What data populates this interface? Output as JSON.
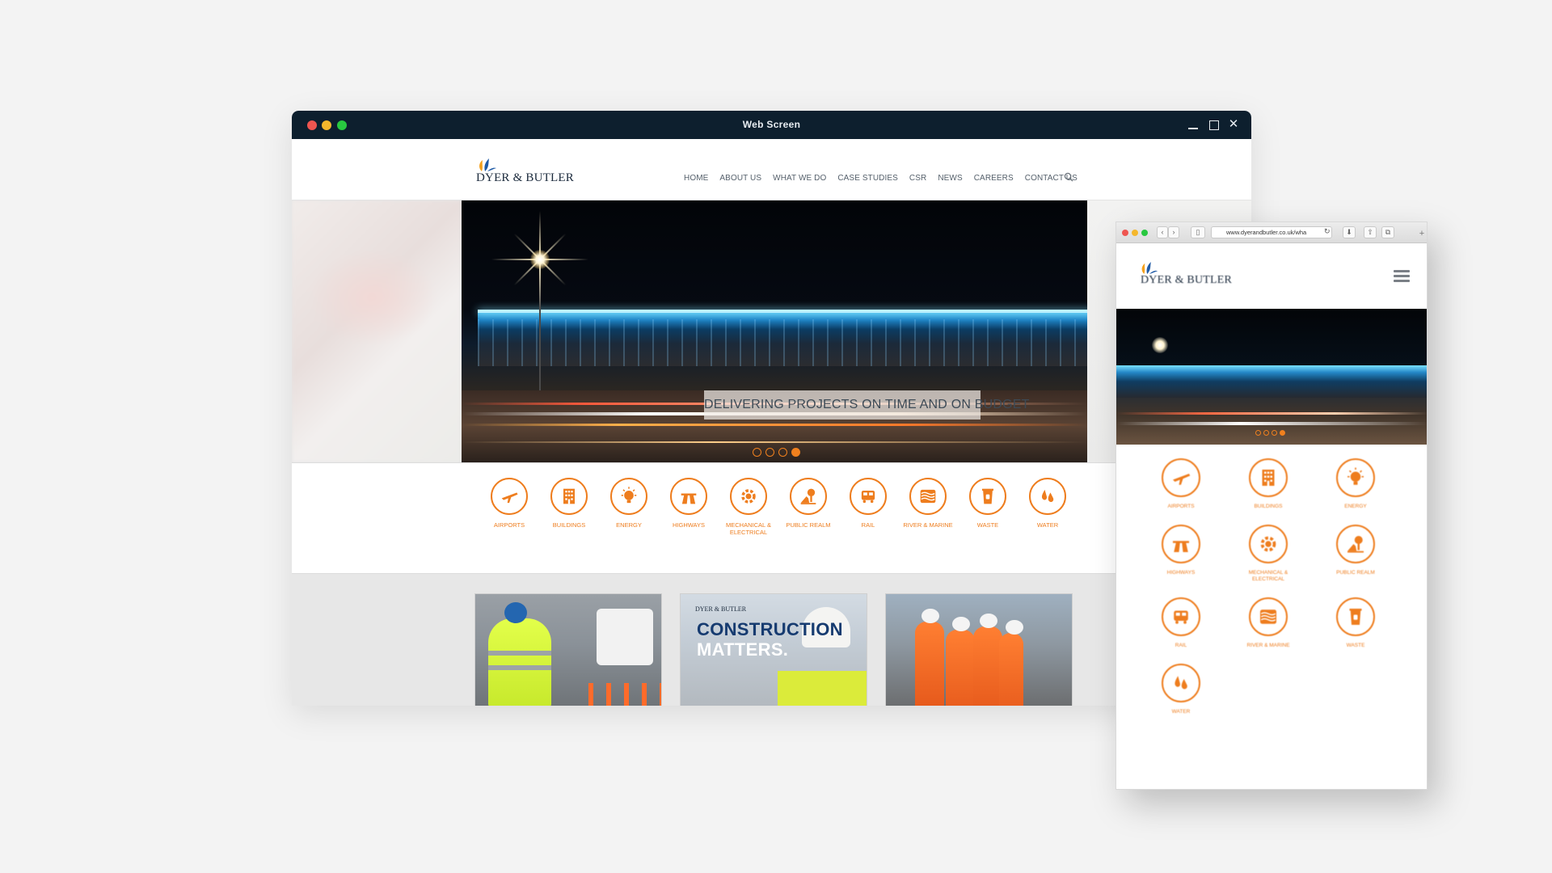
{
  "desktop": {
    "window_title": "Web Screen",
    "brand": "DYER & BUTLER",
    "nav": [
      "HOME",
      "ABOUT US",
      "WHAT WE DO",
      "CASE STUDIES",
      "CSR",
      "NEWS",
      "CAREERS",
      "CONTACT US"
    ],
    "hero_caption": "DELIVERING PROJECTS ON TIME AND ON BUDGET",
    "slider_total": 4,
    "slider_active": 4,
    "services": [
      "AIRPORTS",
      "BUILDINGS",
      "ENERGY",
      "HIGHWAYS",
      "MECHANICAL &\nELECTRICAL",
      "PUBLIC REALM",
      "RAIL",
      "RIVER & MARINE",
      "WASTE",
      "WATER"
    ],
    "cards": {
      "card2_logo": "DYER & BUTLER",
      "card2_title_line1": "CONSTRUCTION",
      "card2_title_line2": "MATTERS."
    }
  },
  "mobile": {
    "url": "www.dyerandbutler.co.uk/wha",
    "brand": "DYER & BUTLER",
    "slider_active": 4,
    "services": [
      "AIRPORTS",
      "BUILDINGS",
      "ENERGY",
      "HIGHWAYS",
      "MECHANICAL &\nELECTRICAL",
      "PUBLIC REALM",
      "RAIL",
      "RIVER & MARINE",
      "WASTE",
      "WATER"
    ]
  },
  "colors": {
    "accent": "#ee7d1e",
    "titlebar": "#0d1f2e",
    "brand_navy": "#1b2a3c"
  },
  "icons": [
    "airplane-icon",
    "building-icon",
    "lightbulb-icon",
    "highway-icon",
    "gear-bulb-icon",
    "park-icon",
    "train-icon",
    "waves-icon",
    "bin-icon",
    "water-drop-icon"
  ]
}
